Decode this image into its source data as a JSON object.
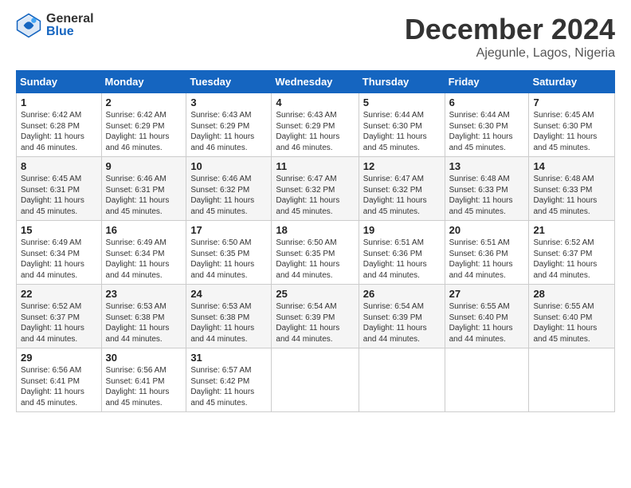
{
  "logo": {
    "general": "General",
    "blue": "Blue"
  },
  "header": {
    "month": "December 2024",
    "location": "Ajegunle, Lagos, Nigeria"
  },
  "weekdays": [
    "Sunday",
    "Monday",
    "Tuesday",
    "Wednesday",
    "Thursday",
    "Friday",
    "Saturday"
  ],
  "weeks": [
    [
      {
        "day": "1",
        "sunrise": "6:42 AM",
        "sunset": "6:28 PM",
        "daylight": "11 hours and 46 minutes."
      },
      {
        "day": "2",
        "sunrise": "6:42 AM",
        "sunset": "6:29 PM",
        "daylight": "11 hours and 46 minutes."
      },
      {
        "day": "3",
        "sunrise": "6:43 AM",
        "sunset": "6:29 PM",
        "daylight": "11 hours and 46 minutes."
      },
      {
        "day": "4",
        "sunrise": "6:43 AM",
        "sunset": "6:29 PM",
        "daylight": "11 hours and 46 minutes."
      },
      {
        "day": "5",
        "sunrise": "6:44 AM",
        "sunset": "6:30 PM",
        "daylight": "11 hours and 45 minutes."
      },
      {
        "day": "6",
        "sunrise": "6:44 AM",
        "sunset": "6:30 PM",
        "daylight": "11 hours and 45 minutes."
      },
      {
        "day": "7",
        "sunrise": "6:45 AM",
        "sunset": "6:30 PM",
        "daylight": "11 hours and 45 minutes."
      }
    ],
    [
      {
        "day": "8",
        "sunrise": "6:45 AM",
        "sunset": "6:31 PM",
        "daylight": "11 hours and 45 minutes."
      },
      {
        "day": "9",
        "sunrise": "6:46 AM",
        "sunset": "6:31 PM",
        "daylight": "11 hours and 45 minutes."
      },
      {
        "day": "10",
        "sunrise": "6:46 AM",
        "sunset": "6:32 PM",
        "daylight": "11 hours and 45 minutes."
      },
      {
        "day": "11",
        "sunrise": "6:47 AM",
        "sunset": "6:32 PM",
        "daylight": "11 hours and 45 minutes."
      },
      {
        "day": "12",
        "sunrise": "6:47 AM",
        "sunset": "6:32 PM",
        "daylight": "11 hours and 45 minutes."
      },
      {
        "day": "13",
        "sunrise": "6:48 AM",
        "sunset": "6:33 PM",
        "daylight": "11 hours and 45 minutes."
      },
      {
        "day": "14",
        "sunrise": "6:48 AM",
        "sunset": "6:33 PM",
        "daylight": "11 hours and 45 minutes."
      }
    ],
    [
      {
        "day": "15",
        "sunrise": "6:49 AM",
        "sunset": "6:34 PM",
        "daylight": "11 hours and 44 minutes."
      },
      {
        "day": "16",
        "sunrise": "6:49 AM",
        "sunset": "6:34 PM",
        "daylight": "11 hours and 44 minutes."
      },
      {
        "day": "17",
        "sunrise": "6:50 AM",
        "sunset": "6:35 PM",
        "daylight": "11 hours and 44 minutes."
      },
      {
        "day": "18",
        "sunrise": "6:50 AM",
        "sunset": "6:35 PM",
        "daylight": "11 hours and 44 minutes."
      },
      {
        "day": "19",
        "sunrise": "6:51 AM",
        "sunset": "6:36 PM",
        "daylight": "11 hours and 44 minutes."
      },
      {
        "day": "20",
        "sunrise": "6:51 AM",
        "sunset": "6:36 PM",
        "daylight": "11 hours and 44 minutes."
      },
      {
        "day": "21",
        "sunrise": "6:52 AM",
        "sunset": "6:37 PM",
        "daylight": "11 hours and 44 minutes."
      }
    ],
    [
      {
        "day": "22",
        "sunrise": "6:52 AM",
        "sunset": "6:37 PM",
        "daylight": "11 hours and 44 minutes."
      },
      {
        "day": "23",
        "sunrise": "6:53 AM",
        "sunset": "6:38 PM",
        "daylight": "11 hours and 44 minutes."
      },
      {
        "day": "24",
        "sunrise": "6:53 AM",
        "sunset": "6:38 PM",
        "daylight": "11 hours and 44 minutes."
      },
      {
        "day": "25",
        "sunrise": "6:54 AM",
        "sunset": "6:39 PM",
        "daylight": "11 hours and 44 minutes."
      },
      {
        "day": "26",
        "sunrise": "6:54 AM",
        "sunset": "6:39 PM",
        "daylight": "11 hours and 44 minutes."
      },
      {
        "day": "27",
        "sunrise": "6:55 AM",
        "sunset": "6:40 PM",
        "daylight": "11 hours and 44 minutes."
      },
      {
        "day": "28",
        "sunrise": "6:55 AM",
        "sunset": "6:40 PM",
        "daylight": "11 hours and 45 minutes."
      }
    ],
    [
      {
        "day": "29",
        "sunrise": "6:56 AM",
        "sunset": "6:41 PM",
        "daylight": "11 hours and 45 minutes."
      },
      {
        "day": "30",
        "sunrise": "6:56 AM",
        "sunset": "6:41 PM",
        "daylight": "11 hours and 45 minutes."
      },
      {
        "day": "31",
        "sunrise": "6:57 AM",
        "sunset": "6:42 PM",
        "daylight": "11 hours and 45 minutes."
      },
      null,
      null,
      null,
      null
    ]
  ],
  "labels": {
    "sunrise": "Sunrise:",
    "sunset": "Sunset:",
    "daylight": "Daylight:"
  }
}
